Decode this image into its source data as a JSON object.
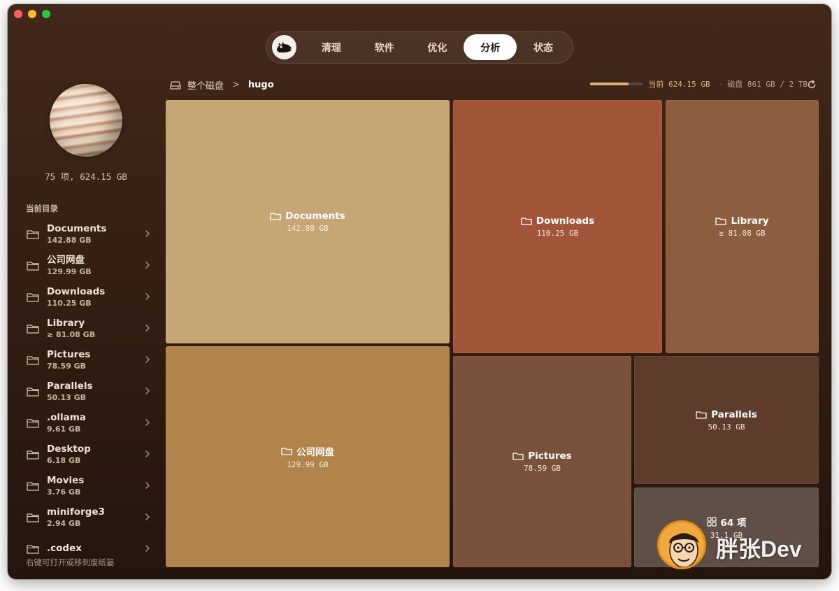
{
  "colors": {
    "documents": "#c7a675",
    "company_drive": "#b3834c",
    "downloads": "#a3553a",
    "library": "#8d5e3e",
    "pictures": "#7a523c",
    "parallels": "#5e3c2c",
    "others": "#5f4f46",
    "accent": "#d9b27a"
  },
  "tabs": [
    {
      "label": "清理",
      "active": false
    },
    {
      "label": "软件",
      "active": false
    },
    {
      "label": "优化",
      "active": false
    },
    {
      "label": "分析",
      "active": true
    },
    {
      "label": "状态",
      "active": false
    }
  ],
  "sidebar": {
    "summary": "75 项, 624.15 GB",
    "section_title": "当前目录",
    "items": [
      {
        "name": "Documents",
        "size": "142.88 GB"
      },
      {
        "name": "公司网盘",
        "size": "129.99 GB"
      },
      {
        "name": "Downloads",
        "size": "110.25 GB"
      },
      {
        "name": "Library",
        "size": "≥ 81.08 GB"
      },
      {
        "name": "Pictures",
        "size": "78.59 GB"
      },
      {
        "name": "Parallels",
        "size": "50.13 GB"
      },
      {
        "name": ".ollama",
        "size": "9.61 GB"
      },
      {
        "name": "Desktop",
        "size": "6.18 GB"
      },
      {
        "name": "Movies",
        "size": "3.76 GB"
      },
      {
        "name": "miniforge3",
        "size": "2.94 GB"
      },
      {
        "name": ".codex",
        "size": ""
      }
    ],
    "footer_hint": "右键可打开或移到废纸篓"
  },
  "breadcrumb": {
    "root": "整个磁盘",
    "separator": ">",
    "current": "hugo"
  },
  "usage": {
    "current_label": "当前 624.15 GB",
    "separator": "·",
    "disk_label": "磁盘 861 GB / 2 TB",
    "fill_fraction": 0.72
  },
  "treemap": {
    "documents": {
      "name": "Documents",
      "size": "142.88 GB"
    },
    "company_drive": {
      "name": "公司网盘",
      "size": "129.99 GB"
    },
    "downloads": {
      "name": "Downloads",
      "size": "110.25 GB"
    },
    "library": {
      "name": "Library",
      "size": "≥ 81.08 GB"
    },
    "pictures": {
      "name": "Pictures",
      "size": "78.59 GB"
    },
    "parallels": {
      "name": "Parallels",
      "size": "50.13 GB"
    },
    "others": {
      "name": "64 项",
      "size": "31.1 GB"
    }
  },
  "watermark": {
    "text": "胖张Dev"
  }
}
